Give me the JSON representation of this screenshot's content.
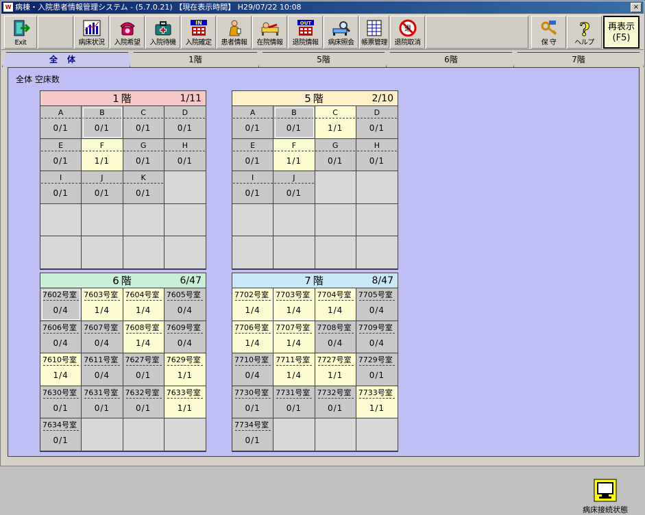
{
  "window": {
    "title": "病棟・入院患者情報管理システム - (5.7.0.21) 【現在表示時間】 H29/07/22 10:08",
    "close": "×"
  },
  "toolbar": {
    "exit": "Exit",
    "bed_status": "病床状況",
    "admission_request": "入院希望",
    "admission_waiting": "入院待機",
    "admission_confirm": "入院確定",
    "patient_info": "患者情報",
    "inpatient_info": "在院情報",
    "discharge_info": "退院情報",
    "bed_inquiry": "病床照会",
    "report_manage": "帳票管理",
    "discharge_cancel": "退院取消",
    "maintenance": "保 守",
    "help": "ヘルプ",
    "refresh_line1": "再表示",
    "refresh_line2": "(F5)"
  },
  "tabs": [
    "全体",
    "1階",
    "5階",
    "6階",
    "7階"
  ],
  "content": {
    "heading": "全体 空床数",
    "status_label": "病床接続状態"
  },
  "floors": [
    {
      "name": "1階",
      "count": "1/11",
      "color": "#f8c8c8",
      "cells": [
        {
          "n": "A",
          "v": "0/1",
          "c": "gray"
        },
        {
          "n": "B",
          "v": "0/1",
          "c": "gray"
        },
        {
          "n": "C",
          "v": "0/1",
          "c": "gray"
        },
        {
          "n": "D",
          "v": "0/1",
          "c": "gray"
        },
        {
          "n": "E",
          "v": "0/1",
          "c": "gray"
        },
        {
          "n": "F",
          "v": "1/1",
          "c": "yellow"
        },
        {
          "n": "G",
          "v": "0/1",
          "c": "gray"
        },
        {
          "n": "H",
          "v": "0/1",
          "c": "gray"
        },
        {
          "n": "I",
          "v": "0/1",
          "c": "gray"
        },
        {
          "n": "J",
          "v": "0/1",
          "c": "gray"
        },
        {
          "n": "K",
          "v": "0/1",
          "c": "gray"
        }
      ]
    },
    {
      "name": "5階",
      "count": "2/10",
      "color": "#fdf0c8",
      "cells": [
        {
          "n": "A",
          "v": "0/1",
          "c": "gray"
        },
        {
          "n": "B",
          "v": "0/1",
          "c": "gray"
        },
        {
          "n": "C",
          "v": "1/1",
          "c": "yellow"
        },
        {
          "n": "D",
          "v": "0/1",
          "c": "gray"
        },
        {
          "n": "E",
          "v": "0/1",
          "c": "gray"
        },
        {
          "n": "F",
          "v": "1/1",
          "c": "yellow"
        },
        {
          "n": "G",
          "v": "0/1",
          "c": "gray"
        },
        {
          "n": "H",
          "v": "0/1",
          "c": "gray"
        },
        {
          "n": "I",
          "v": "0/1",
          "c": "gray"
        },
        {
          "n": "J",
          "v": "0/1",
          "c": "gray"
        }
      ]
    },
    {
      "name": "6階",
      "count": "6/47",
      "color": "#c8f0d8",
      "cells": [
        {
          "n": "7602号室",
          "v": "0/4",
          "c": "gray"
        },
        {
          "n": "7603号室",
          "v": "1/4",
          "c": "yellow"
        },
        {
          "n": "7604号室",
          "v": "1/4",
          "c": "yellow"
        },
        {
          "n": "7605号室",
          "v": "0/4",
          "c": "gray"
        },
        {
          "n": "7606号室",
          "v": "0/4",
          "c": "gray"
        },
        {
          "n": "7607号室",
          "v": "0/4",
          "c": "gray"
        },
        {
          "n": "7608号室",
          "v": "1/4",
          "c": "yellow"
        },
        {
          "n": "7609号室",
          "v": "0/4",
          "c": "gray"
        },
        {
          "n": "7610号室",
          "v": "1/4",
          "c": "yellow"
        },
        {
          "n": "7611号室",
          "v": "0/4",
          "c": "gray"
        },
        {
          "n": "7627号室",
          "v": "0/1",
          "c": "gray"
        },
        {
          "n": "7629号室",
          "v": "1/1",
          "c": "yellow"
        },
        {
          "n": "7630号室",
          "v": "0/1",
          "c": "gray"
        },
        {
          "n": "7631号室",
          "v": "0/1",
          "c": "gray"
        },
        {
          "n": "7632号室",
          "v": "0/1",
          "c": "gray"
        },
        {
          "n": "7633号室",
          "v": "1/1",
          "c": "yellow"
        },
        {
          "n": "7634号室",
          "v": "0/1",
          "c": "gray"
        }
      ]
    },
    {
      "name": "7階",
      "count": "8/47",
      "color": "#c8e8f8",
      "cells": [
        {
          "n": "7702号室",
          "v": "1/4",
          "c": "yellow"
        },
        {
          "n": "7703号室",
          "v": "1/4",
          "c": "yellow"
        },
        {
          "n": "7704号室",
          "v": "1/4",
          "c": "yellow"
        },
        {
          "n": "7705号室",
          "v": "0/4",
          "c": "gray"
        },
        {
          "n": "7706号室",
          "v": "1/4",
          "c": "yellow"
        },
        {
          "n": "7707号室",
          "v": "1/4",
          "c": "yellow"
        },
        {
          "n": "7708号室",
          "v": "0/4",
          "c": "gray"
        },
        {
          "n": "7709号室",
          "v": "0/4",
          "c": "gray"
        },
        {
          "n": "7710号室",
          "v": "0/4",
          "c": "gray"
        },
        {
          "n": "7711号室",
          "v": "1/4",
          "c": "yellow"
        },
        {
          "n": "7727号室",
          "v": "1/1",
          "c": "yellow"
        },
        {
          "n": "7729号室",
          "v": "0/1",
          "c": "gray"
        },
        {
          "n": "7730号室",
          "v": "0/1",
          "c": "gray"
        },
        {
          "n": "7731号室",
          "v": "0/1",
          "c": "gray"
        },
        {
          "n": "7732号室",
          "v": "0/1",
          "c": "gray"
        },
        {
          "n": "7733号室",
          "v": "1/1",
          "c": "yellow"
        },
        {
          "n": "7734号室",
          "v": "0/1",
          "c": "gray"
        }
      ]
    }
  ]
}
